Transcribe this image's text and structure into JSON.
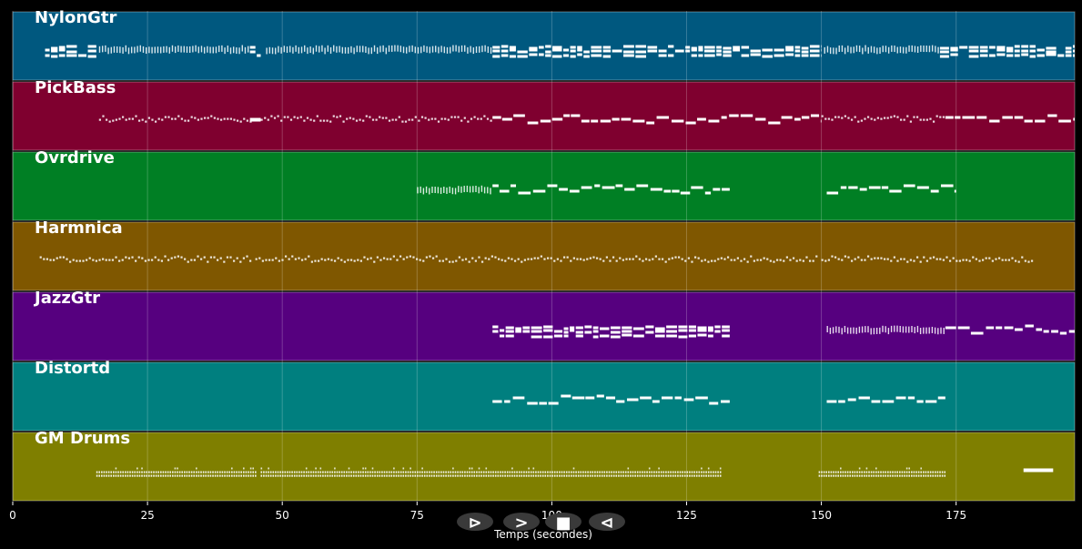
{
  "chart_data": {
    "type": "piano-roll",
    "xlabel": "Temps (secondes)",
    "xlim": [
      0,
      197
    ],
    "xticks": [
      0,
      25,
      50,
      75,
      100,
      125,
      150,
      175
    ],
    "grid": true,
    "tracks": [
      {
        "name": "NylonGtr",
        "color": "#00587f",
        "segments": [
          {
            "start": 6,
            "end": 15.5,
            "style": "chords"
          },
          {
            "start": 16,
            "end": 44,
            "style": "dense"
          },
          {
            "start": 44,
            "end": 46,
            "style": "chords"
          },
          {
            "start": 47,
            "end": 89,
            "style": "dense"
          },
          {
            "start": 89,
            "end": 150,
            "style": "chords"
          },
          {
            "start": 150.5,
            "end": 172,
            "style": "dense"
          },
          {
            "start": 172,
            "end": 197,
            "style": "chords"
          }
        ]
      },
      {
        "name": "PickBass",
        "color": "#7f002f",
        "segments": [
          {
            "start": 16,
            "end": 44,
            "style": "sparse"
          },
          {
            "start": 44,
            "end": 46,
            "style": "bar"
          },
          {
            "start": 46,
            "end": 89,
            "style": "sparse"
          },
          {
            "start": 89,
            "end": 150,
            "style": "melody"
          },
          {
            "start": 150,
            "end": 173,
            "style": "sparse"
          },
          {
            "start": 173,
            "end": 197,
            "style": "melody"
          }
        ]
      },
      {
        "name": "Ovrdrive",
        "color": "#007f24",
        "segments": [
          {
            "start": 75,
            "end": 89,
            "style": "dense"
          },
          {
            "start": 89,
            "end": 133,
            "style": "melody"
          },
          {
            "start": 151,
            "end": 175,
            "style": "melody"
          }
        ]
      },
      {
        "name": "Harmnica",
        "color": "#7f5700",
        "segments": [
          {
            "start": 5,
            "end": 44,
            "style": "sparse"
          },
          {
            "start": 45,
            "end": 149,
            "style": "sparse"
          },
          {
            "start": 150,
            "end": 189,
            "style": "sparse"
          }
        ]
      },
      {
        "name": "JazzGtr",
        "color": "#56007f",
        "segments": [
          {
            "start": 89,
            "end": 133,
            "style": "chords"
          },
          {
            "start": 151,
            "end": 173,
            "style": "dense"
          },
          {
            "start": 173,
            "end": 197,
            "style": "melody"
          }
        ]
      },
      {
        "name": "Distortd",
        "color": "#007f7f",
        "segments": [
          {
            "start": 89,
            "end": 133,
            "style": "melody"
          },
          {
            "start": 151,
            "end": 173,
            "style": "melody"
          }
        ]
      },
      {
        "name": "GM Drums",
        "color": "#7f7f00",
        "segments": [
          {
            "start": 15.5,
            "end": 45,
            "style": "drums"
          },
          {
            "start": 46,
            "end": 131.5,
            "style": "drums"
          },
          {
            "start": 149.5,
            "end": 173,
            "style": "drums"
          },
          {
            "start": 187.5,
            "end": 193,
            "style": "bar"
          }
        ]
      }
    ]
  },
  "controls": [
    {
      "name": "play-outline-icon",
      "glyph": "⊳"
    },
    {
      "name": "play-icon",
      "glyph": ">"
    },
    {
      "name": "stop-icon",
      "glyph": "■"
    },
    {
      "name": "rewind-icon",
      "glyph": "⊲"
    }
  ],
  "colors": {
    "background": "#000000",
    "track_border": "#ffffff",
    "note": "#ffffff",
    "grid": "#ffffff",
    "control_bg": "#3a3a3a"
  }
}
